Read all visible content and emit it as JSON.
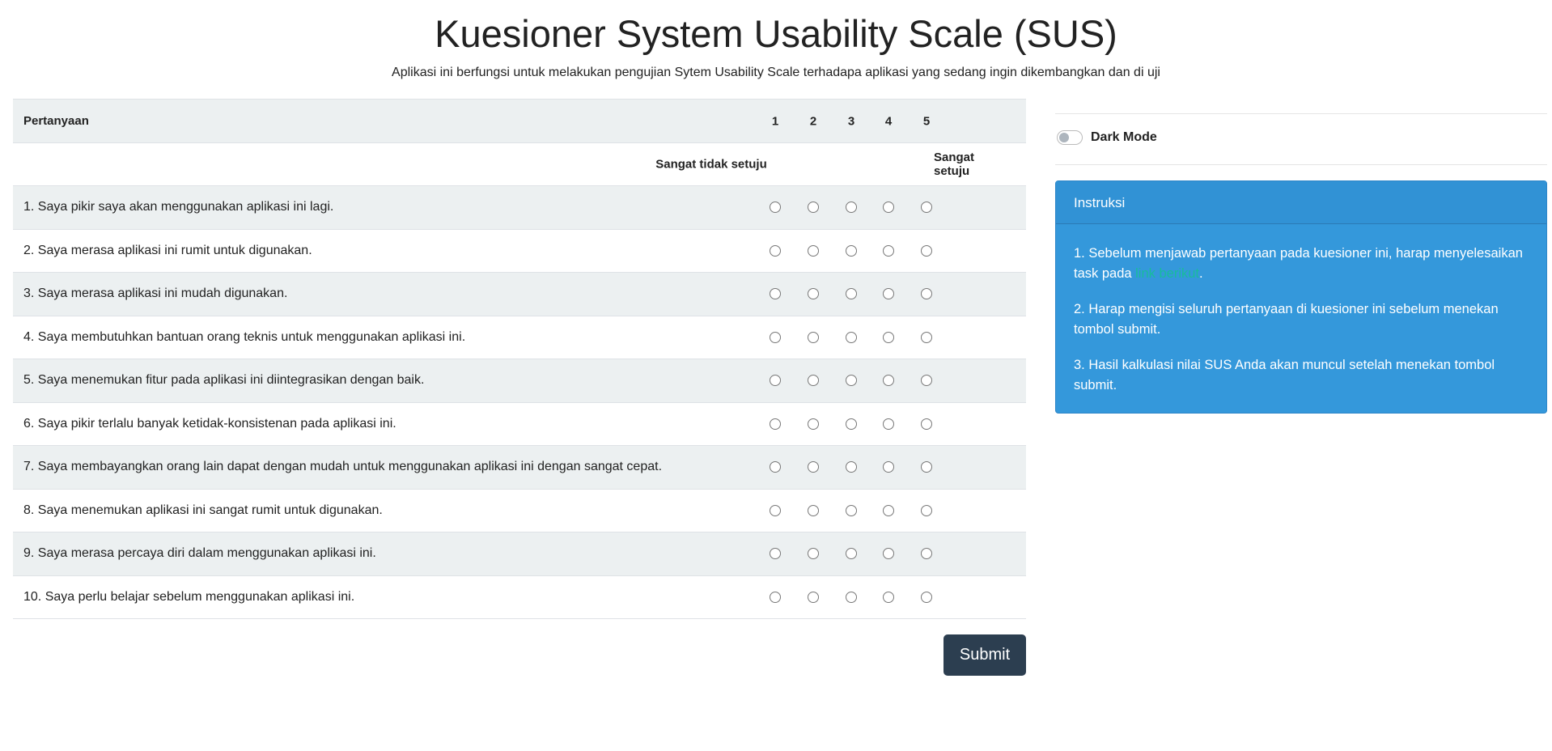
{
  "title": "Kuesioner System Usability Scale (SUS)",
  "subtitle": "Aplikasi ini berfungsi untuk melakukan pengujian Sytem Usability Scale terhadapa aplikasi yang sedang ingin dikembangkan dan di uji",
  "table": {
    "header": "Pertanyaan",
    "scale": [
      "1",
      "2",
      "3",
      "4",
      "5"
    ],
    "low_label": "Sangat tidak setuju",
    "high_label": "Sangat setuju",
    "questions": [
      "1. Saya pikir saya akan menggunakan aplikasi ini lagi.",
      "2. Saya merasa aplikasi ini rumit untuk digunakan.",
      "3. Saya merasa aplikasi ini mudah digunakan.",
      "4. Saya membutuhkan bantuan orang teknis untuk menggunakan aplikasi ini.",
      "5. Saya menemukan fitur pada aplikasi ini diintegrasikan dengan baik.",
      "6. Saya pikir terlalu banyak ketidak-konsistenan pada aplikasi ini.",
      "7. Saya membayangkan orang lain dapat dengan mudah untuk menggunakan aplikasi ini dengan sangat cepat.",
      "8. Saya menemukan aplikasi ini sangat rumit untuk digunakan.",
      "9. Saya merasa percaya diri dalam menggunakan aplikasi ini.",
      "10. Saya perlu belajar sebelum menggunakan aplikasi ini."
    ]
  },
  "submit_label": "Submit",
  "dark_mode_label": "Dark Mode",
  "dark_mode_on": false,
  "instructions": {
    "title": "Instruksi",
    "item1_pre": "1. Sebelum menjawab pertanyaan pada kuesioner ini, harap menyelesaikan task pada ",
    "item1_link": "link berikut",
    "item1_post": ".",
    "item2": "2. Harap mengisi seluruh pertanyaan di kuesioner ini sebelum menekan tombol submit.",
    "item3": "3. Hasil kalkulasi nilai SUS Anda akan muncul setelah menekan tombol submit."
  },
  "colors": {
    "primary": "#2c3e50",
    "info": "#3498db",
    "link": "#18bc9c"
  }
}
